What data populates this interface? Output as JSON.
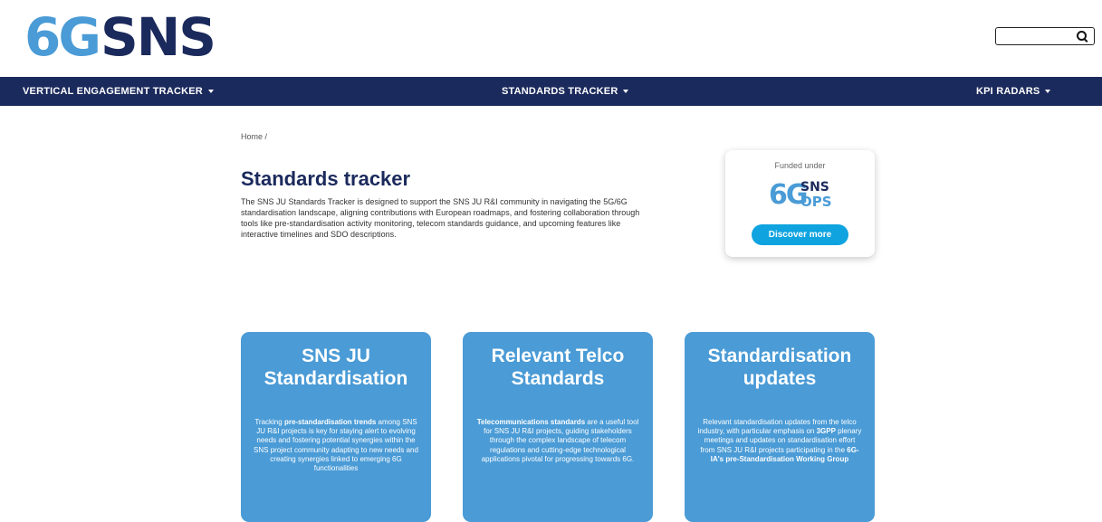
{
  "header": {
    "logo": {
      "mark": "6G",
      "word": "SNS"
    },
    "search": {
      "placeholder": "",
      "value": ""
    },
    "search_icon": "search-icon"
  },
  "nav": {
    "items": [
      {
        "label": "VERTICAL ENGAGEMENT TRACKER"
      },
      {
        "label": "STANDARDS TRACKER"
      },
      {
        "label": "KPI RADARS"
      }
    ],
    "background": "#1b2a5c"
  },
  "breadcrumb": {
    "home": "Home",
    "separator": "/"
  },
  "page": {
    "title": "Standards tracker",
    "intro": "The SNS JU Standards Tracker is designed to support the SNS JU R&I community in navigating the 5G/6G standardisation landscape, aligning contributions with European roadmaps, and fostering collaboration through tools like pre-standardisation activity monitoring, telecom standards guidance, and upcoming features like interactive timelines and SDO descriptions."
  },
  "funded": {
    "label": "Funded under",
    "logo": {
      "mark": "6G",
      "word": "SNS",
      "sub": "OPS"
    },
    "button": "Discover more",
    "button_color": "#0fa3e0"
  },
  "cards": [
    {
      "title": "SNS JU Standardisation",
      "desc": [
        {
          "t": "Tracking ",
          "b": false
        },
        {
          "t": "pre-standardisation trends",
          "b": true
        },
        {
          "t": " among SNS JU R&I projects is key for staying alert to evolving needs and fostering potential synergies within the SNS project community adapting to new needs and creating synergies linked to emerging 6G functionalities",
          "b": false
        }
      ]
    },
    {
      "title": "Relevant Telco Standards",
      "desc": [
        {
          "t": "Telecommunications standards",
          "b": true
        },
        {
          "t": " are a useful tool for SNS JU R&I projects, guiding stakeholders through the complex landscape of telecom regulations and cutting-edge technological applications pivotal for progressing towards 6G.",
          "b": false
        }
      ]
    },
    {
      "title": "Standardisation updates",
      "desc": [
        {
          "t": "Relevant standardisation updates from the telco industry, with particular emphasis on ",
          "b": false
        },
        {
          "t": "3GPP",
          "b": true
        },
        {
          "t": " plenary meetings and updates on standardisation effort from SNS JU R&I projects participating in the ",
          "b": false
        },
        {
          "t": "6G-IA's pre-Standardisation Working Group",
          "b": true
        }
      ]
    }
  ],
  "colors": {
    "brand_dark": "#1b2a5c",
    "brand_light": "#4a9bd6",
    "card": "#4a9bd6"
  }
}
